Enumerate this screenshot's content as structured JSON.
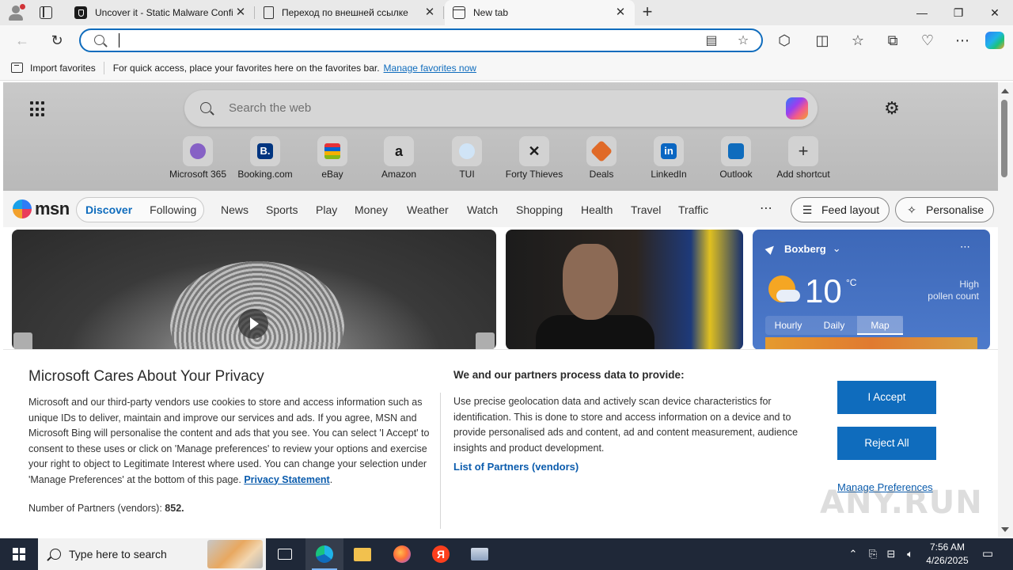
{
  "browser": {
    "tabs": [
      {
        "title": "Uncover it - Static Malware Confi",
        "favicon": "shield-icon",
        "active": false
      },
      {
        "title": "Переход по внешней ссылке",
        "favicon": "document-icon",
        "active": false
      },
      {
        "title": "New tab",
        "favicon": "new-tab-icon",
        "active": true
      }
    ],
    "address": {
      "value": "",
      "placeholder": ""
    },
    "favorites_bar": {
      "import_label": "Import favorites",
      "hint": "For quick access, place your favorites here on the favorites bar.",
      "manage_link": "Manage favorites now"
    }
  },
  "newtab": {
    "search_placeholder": "Search the web",
    "shortcuts": [
      {
        "label": "Microsoft 365",
        "logo": "",
        "color": "#8661c5"
      },
      {
        "label": "Booking.com",
        "logo": "B.",
        "color": "#003580"
      },
      {
        "label": "eBay",
        "logo": "",
        "color": "#e53238"
      },
      {
        "label": "Amazon",
        "logo": "a",
        "color": "#1b1b1b"
      },
      {
        "label": "TUI",
        "logo": "",
        "color": "#d0e4f6"
      },
      {
        "label": "Forty Thieves",
        "logo": "",
        "color": "#1b1b1b"
      },
      {
        "label": "Deals",
        "logo": "",
        "color": "#e06a28"
      },
      {
        "label": "LinkedIn",
        "logo": "in",
        "color": "#0a66c2"
      },
      {
        "label": "Outlook",
        "logo": "",
        "color": "#0f6cbd"
      },
      {
        "label": "Add shortcut",
        "logo": "+",
        "color": "#d2d2d2"
      }
    ],
    "feed_tabs": [
      "Discover",
      "Following"
    ],
    "nav": [
      "News",
      "Sports",
      "Play",
      "Money",
      "Weather",
      "Watch",
      "Shopping",
      "Health",
      "Travel",
      "Traffic"
    ],
    "feed_layout": "Feed layout",
    "personalise": "Personalise",
    "weather": {
      "location": "Boxberg",
      "temp": "10",
      "unit": "°C",
      "pollen_line1": "High",
      "pollen_line2": "pollen count",
      "tabs": [
        "Hourly",
        "Daily",
        "Map"
      ]
    }
  },
  "privacy": {
    "title": "Microsoft Cares About Your Privacy",
    "body": "Microsoft and our third-party vendors use cookies to store and access information such as unique IDs to deliver, maintain and improve our services and ads. If you agree, MSN and Microsoft Bing will personalise the content and ads that you see. You can select 'I Accept' to consent to these uses or click on 'Manage preferences' to review your options and exercise your right to object to Legitimate Interest where used.  You can change your selection under 'Manage Preferences' at the bottom of this page.",
    "privacy_link": "Privacy Statement",
    "partners_label": "Number of Partners (vendors):",
    "partners_count": "852.",
    "heading2": "We and our partners process data to provide:",
    "purpose": "Use precise geolocation data and actively scan device characteristics for identification. This is done to store and access information on a device and to provide personalised ads and content, ad and content measurement, audience insights and product development.",
    "list_partners": "List of Partners (vendors)",
    "accept": "I Accept",
    "reject": "Reject All",
    "manage": "Manage Preferences"
  },
  "watermark": "ANY.RUN",
  "taskbar": {
    "search_placeholder": "Type here to search",
    "time": "7:56 AM",
    "date": "4/26/2025"
  }
}
